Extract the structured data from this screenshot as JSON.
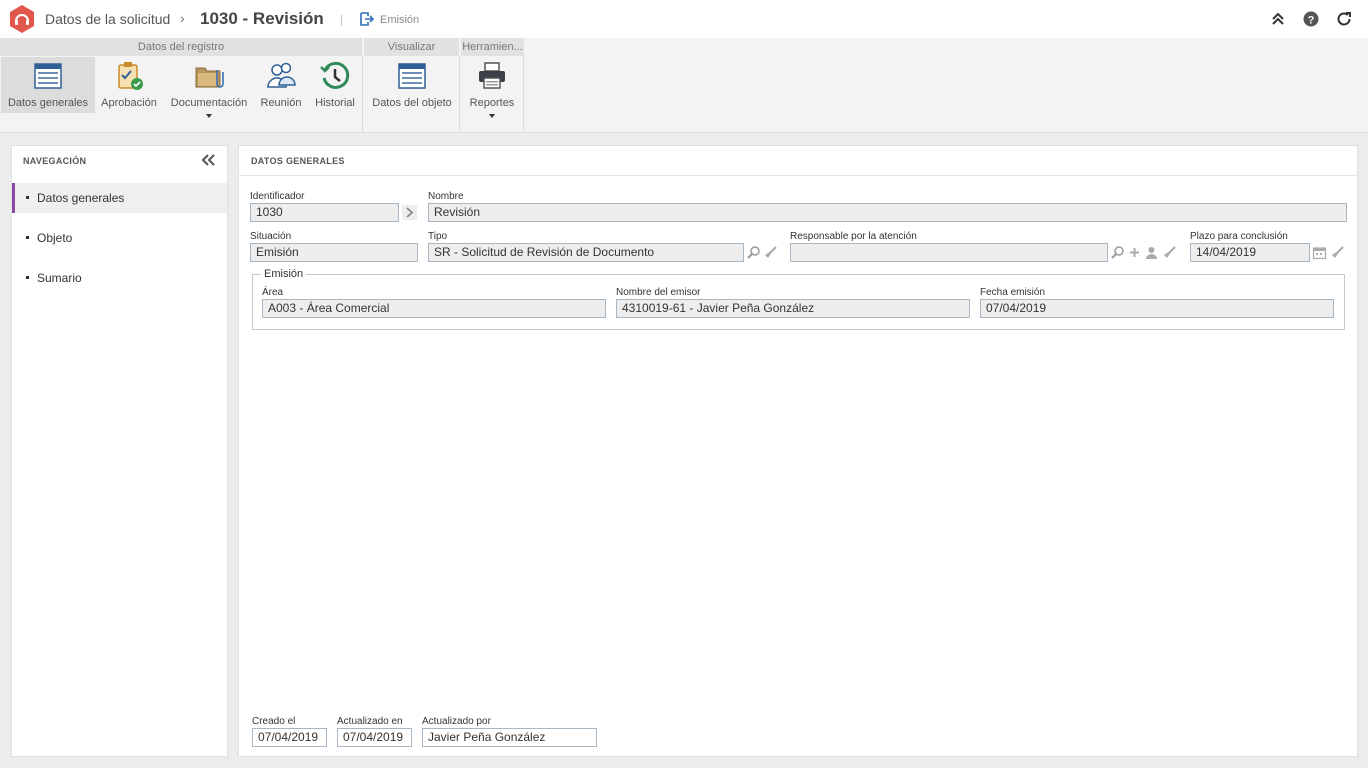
{
  "header": {
    "breadcrumb": "Datos de la solicitud",
    "title": "1030 - Revisión",
    "status": "Emisión"
  },
  "ribbon": {
    "groups": [
      {
        "label": "Datos del registro"
      },
      {
        "label": "Visualizar"
      },
      {
        "label": "Herramien..."
      }
    ],
    "buttons": [
      {
        "label": "Datos generales",
        "icon": "form-icon"
      },
      {
        "label": "Aprobación",
        "icon": "clipboard-check-icon"
      },
      {
        "label": "Documentación",
        "icon": "folder-clip-icon"
      },
      {
        "label": "Reunión",
        "icon": "people-icon"
      },
      {
        "label": "Historial",
        "icon": "history-icon"
      },
      {
        "label": "Datos del objeto",
        "icon": "form-icon"
      },
      {
        "label": "Reportes",
        "icon": "printer-icon"
      }
    ]
  },
  "nav": {
    "title": "NAVEGACIÓN",
    "items": [
      {
        "label": "Datos generales"
      },
      {
        "label": "Objeto"
      },
      {
        "label": "Sumario"
      }
    ]
  },
  "main": {
    "title": "DATOS GENERALES",
    "identificador": {
      "label": "Identificador",
      "value": "1030"
    },
    "nombre": {
      "label": "Nombre",
      "value": "Revisión"
    },
    "situacion": {
      "label": "Situación",
      "value": "Emisión"
    },
    "tipo": {
      "label": "Tipo",
      "value": "SR - Solicitud de Revisión de Documento"
    },
    "responsable": {
      "label": "Responsable por la atención",
      "value": ""
    },
    "plazo": {
      "label": "Plazo para conclusión",
      "value": "14/04/2019"
    },
    "emision": {
      "legend": "Emisión",
      "area": {
        "label": "Área",
        "value": "A003 - Área Comercial"
      },
      "emisor": {
        "label": "Nombre del emisor",
        "value": "4310019-61 - Javier Peña González"
      },
      "fecha": {
        "label": "Fecha emisión",
        "value": "07/04/2019"
      }
    },
    "footer": {
      "creado": {
        "label": "Creado el",
        "value": "07/04/2019"
      },
      "actualizado_en": {
        "label": "Actualizado en",
        "value": "07/04/2019"
      },
      "actualizado_por": {
        "label": "Actualizado por",
        "value": "Javier Peña González"
      }
    }
  },
  "colors": {
    "accent_nav": "#8e4aa8",
    "logo": "#e2574c",
    "field_border": "#a9b6c4"
  }
}
